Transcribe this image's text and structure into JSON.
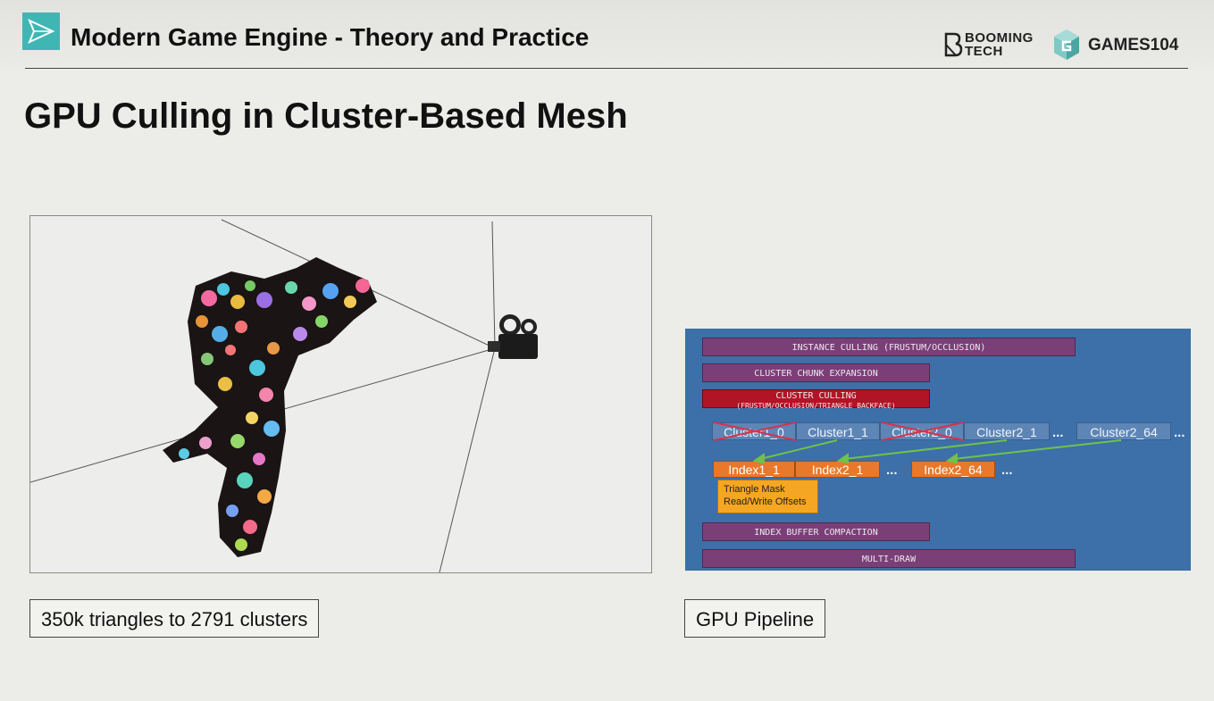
{
  "header": {
    "course_title": "Modern Game Engine - Theory and Practice",
    "booming_line1": "BOOMING",
    "booming_line2": "TECH",
    "games_label": "GAMES104"
  },
  "slide": {
    "title": "GPU Culling in Cluster-Based Mesh"
  },
  "mesh_panel": {
    "caption": "350k triangles to 2791 clusters"
  },
  "pipeline_panel": {
    "caption": "GPU Pipeline",
    "stages": {
      "instance_culling": "INSTANCE CULLING (FRUSTUM/OCCLUSION)",
      "cluster_chunk_expansion": "CLUSTER CHUNK EXPANSION",
      "cluster_culling": "CLUSTER CULLING",
      "cluster_culling_sub": "(FRUSTUM/OCCLUSION/TRIANGLE BACKFACE)",
      "index_buffer_compaction": "INDEX BUFFER COMPACTION",
      "multi_draw": "MULTI-DRAW"
    },
    "clusters": [
      "Cluster1_0",
      "Cluster1_1",
      "Cluster2_0",
      "Cluster2_1",
      "Cluster2_64"
    ],
    "indices": [
      "Index1_1",
      "Index2_1",
      "Index2_64"
    ],
    "ellipsis": "...",
    "triangle_mask_line1": "Triangle Mask",
    "triangle_mask_line2": "Read/Write Offsets"
  },
  "colors": {
    "logo_teal": "#3fb6b4",
    "pipeline_bg": "#3d6fa8",
    "stage_purple": "#7b3f78",
    "stage_red": "#b11525",
    "cluster_blue": "#5d86b7",
    "index_orange": "#e8782c",
    "mask_yellow": "#f5a623"
  }
}
